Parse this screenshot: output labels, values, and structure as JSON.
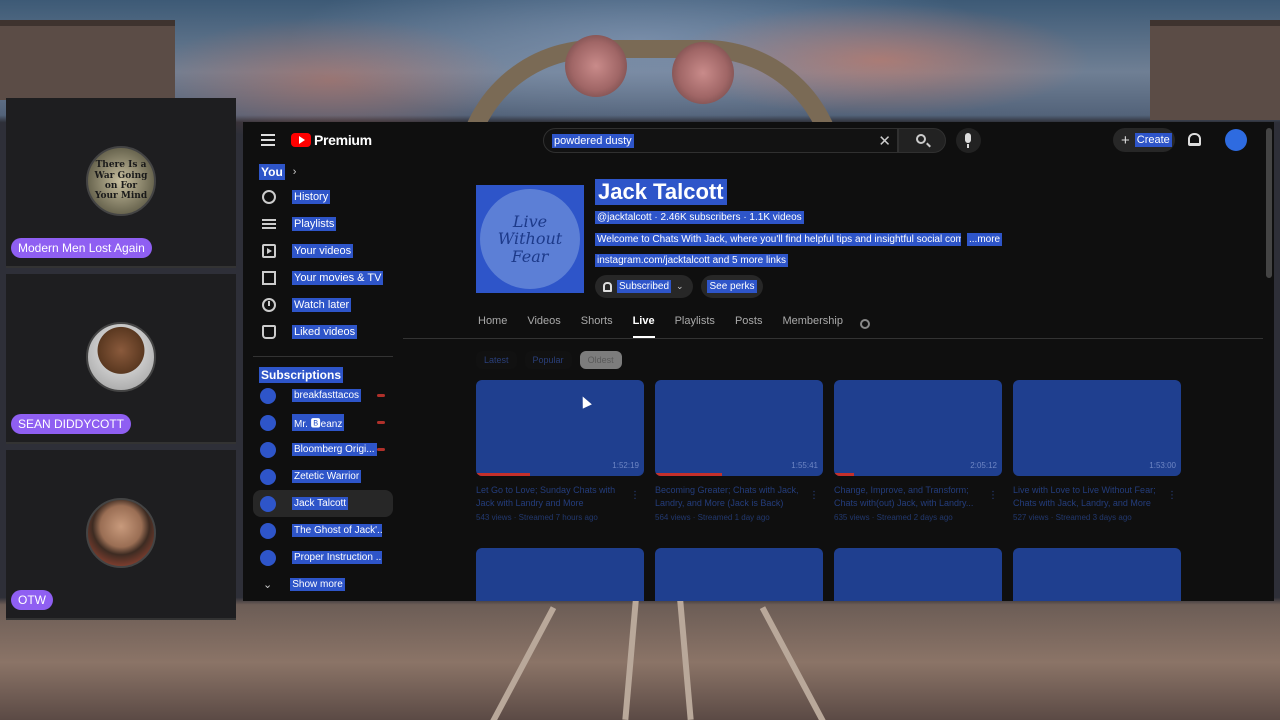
{
  "cams": [
    {
      "name": "Modern Men Lost Again",
      "avatar_text": "There Is a War Going on For Your Mind"
    },
    {
      "name": "SEAN DIDDYCOTT"
    },
    {
      "name": "OTW"
    }
  ],
  "header": {
    "logo": "Premium",
    "search_value": "powdered dusty",
    "create_label": "Create"
  },
  "sidebar": {
    "you_label": "You",
    "items": [
      {
        "label": "History",
        "icon": "history-icon"
      },
      {
        "label": "Playlists",
        "icon": "playlists-icon"
      },
      {
        "label": "Your videos",
        "icon": "your-videos-icon"
      },
      {
        "label": "Your movies & TV",
        "icon": "movies-icon"
      },
      {
        "label": "Watch later",
        "icon": "clock-icon"
      },
      {
        "label": "Liked videos",
        "icon": "thumbs-up-icon"
      }
    ],
    "subscriptions_label": "Subscriptions",
    "subscriptions": [
      {
        "label": "breakfasttacos",
        "live": true
      },
      {
        "label": "Mr. 🅱eanz",
        "live": true
      },
      {
        "label": "Bloomberg Origi...",
        "live": true
      },
      {
        "label": "Zetetic Warrior",
        "live": false
      },
      {
        "label": "Jack Talcott",
        "live": false
      },
      {
        "label": "The Ghost of Jack'...",
        "live": false
      },
      {
        "label": "Proper Instruction ...",
        "live": false
      }
    ],
    "show_more": "Show more"
  },
  "channel": {
    "avatar_text": "Live Without Fear",
    "name": "Jack Talcott",
    "meta": "@jacktalcott · 2.46K subscribers · 1.1K videos",
    "description": "Welcome to Chats With Jack, where you'll find helpful tips and insightful social commen",
    "more_label": "...more",
    "links": "instagram.com/jacktalcott and 5 more links",
    "subscribed_label": "Subscribed",
    "perks_label": "See perks"
  },
  "tabs": [
    "Home",
    "Videos",
    "Shorts",
    "Live",
    "Playlists",
    "Posts",
    "Membership"
  ],
  "active_tab": "Live",
  "chips": [
    "Latest",
    "Popular",
    "Oldest"
  ],
  "active_chip": "Oldest",
  "videos": [
    {
      "title": "Let Go to Love; Sunday Chats with Jack with Landry and More",
      "meta": "543 views · Streamed 7 hours ago",
      "duration": "1:52:19",
      "progress": 0.32
    },
    {
      "title": "Becoming Greater; Chats with Jack, Landry, and More (Jack is Back)",
      "meta": "564 views · Streamed 1 day ago",
      "duration": "1:55:41",
      "progress": 0.4
    },
    {
      "title": "Change, Improve, and Transform; Chats with(out) Jack, with Landry...",
      "meta": "635 views · Streamed 2 days ago",
      "duration": "2:05:12",
      "progress": 0.12
    },
    {
      "title": "Live with Love to Live Without Fear; Chats with Jack, Landry, and More",
      "meta": "527 views · Streamed 3 days ago",
      "duration": "1:53:00",
      "progress": 0.0
    },
    {
      "title": "",
      "meta": "",
      "duration": "",
      "progress": 0
    },
    {
      "title": "",
      "meta": "",
      "duration": "",
      "progress": 0
    },
    {
      "title": "",
      "meta": "",
      "duration": "",
      "progress": 0
    },
    {
      "title": "",
      "meta": "",
      "duration": "",
      "progress": 0
    }
  ],
  "colors": {
    "accent": "#ff0000",
    "selection": "#2e55c9",
    "cam_label": "#8f5ff2",
    "bg": "#0f0f0f"
  }
}
